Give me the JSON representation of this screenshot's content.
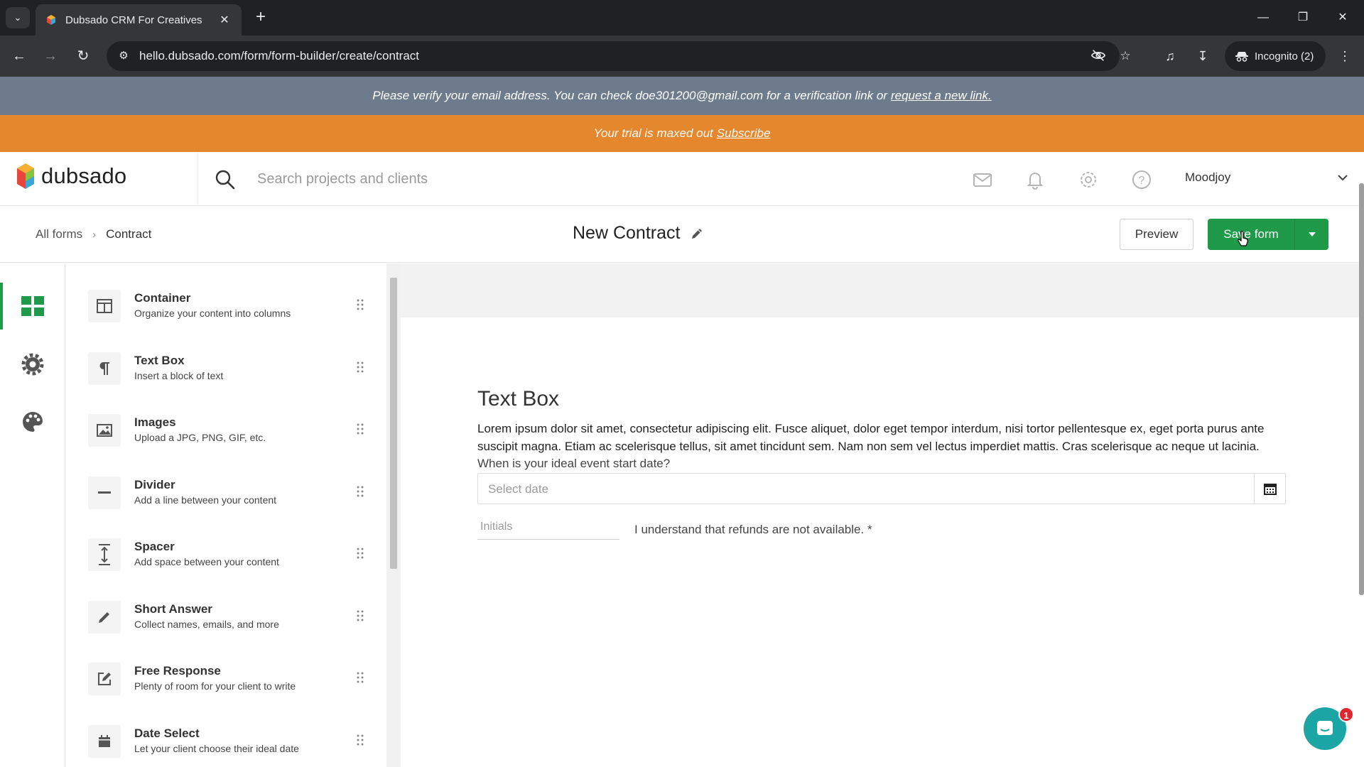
{
  "browser": {
    "tab_title": "Dubsado CRM For Creatives",
    "url": "hello.dubsado.com/form/form-builder/create/contract",
    "profile_label": "Incognito (2)"
  },
  "banners": {
    "verify_text": "Please verify your email address. You can check doe301200@gmail.com for a verification link or",
    "verify_link": "request a new link.",
    "trial_text": "Your trial is maxed out",
    "trial_link": "Subscribe"
  },
  "header": {
    "logo_text": "dubsado",
    "search_placeholder": "Search projects and clients",
    "user_name": "Moodjoy"
  },
  "builder": {
    "breadcrumb_root": "All forms",
    "breadcrumb_current": "Contract",
    "form_title": "New Contract",
    "preview_label": "Preview",
    "save_label": "Save form"
  },
  "elements": [
    {
      "title": "Container",
      "desc": "Organize your content into columns",
      "icon": "container-icon"
    },
    {
      "title": "Text Box",
      "desc": "Insert a block of text",
      "icon": "paragraph-icon"
    },
    {
      "title": "Images",
      "desc": "Upload a JPG, PNG, GIF, etc.",
      "icon": "image-icon"
    },
    {
      "title": "Divider",
      "desc": "Add a line between your content",
      "icon": "minus-icon"
    },
    {
      "title": "Spacer",
      "desc": "Add space between your content",
      "icon": "spacer-icon"
    },
    {
      "title": "Short Answer",
      "desc": "Collect names, emails, and more",
      "icon": "pencil-icon"
    },
    {
      "title": "Free Response",
      "desc": "Plenty of room for your client to write",
      "icon": "edit-square-icon"
    },
    {
      "title": "Date Select",
      "desc": "Let your client choose their ideal date",
      "icon": "calendar-icon"
    }
  ],
  "canvas": {
    "textbox_heading": "Text Box",
    "textbox_body": "Lorem ipsum dolor sit amet, consectetur adipiscing elit. Fusce aliquet, dolor eget tempor interdum, nisi tortor pellentesque ex, eget porta purus ante suscipit magna. Etiam ac scelerisque tellus, sit amet tincidunt sem. Nam non sem vel lectus imperdiet mattis. Cras scelerisque ac neque ut lacinia.",
    "date_question": "When is your ideal event start date?",
    "date_placeholder": "Select date",
    "initials_placeholder": "Initials",
    "acknowledgement": "I understand that refunds are not available. *"
  },
  "chat": {
    "badge_count": "1"
  },
  "colors": {
    "brand_green": "#1f9a48",
    "trial_orange": "#e4872d",
    "verify_gray": "#6d7b8c"
  }
}
